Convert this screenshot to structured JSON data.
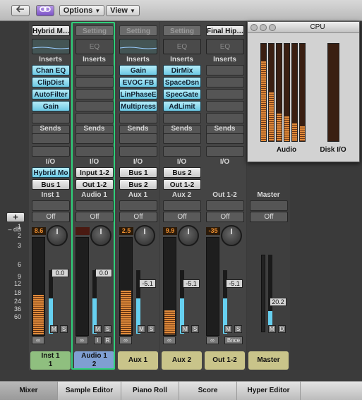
{
  "toolbar": {
    "options_label": "Options",
    "view_label": "View"
  },
  "colors": {
    "plugin": "#6cc9e4",
    "selected_outline": "#2fd07a",
    "fader_fill": "#66d0f0",
    "cpu_meter": "#e08a3a"
  },
  "strip_labels": {
    "inserts": "Inserts",
    "sends": "Sends",
    "io": "I/O",
    "setting": "Setting",
    "eq": "EQ",
    "off": "Off"
  },
  "strips": [
    {
      "setting": "Hybrid M…",
      "inserts": [
        "Chan EQ",
        "ClipDist",
        "AutoFilter",
        "Gain"
      ],
      "input": "Hybrid Mo",
      "output": "Bus 1",
      "title": "Inst 1",
      "peak": "8.6",
      "vol": "0.0",
      "name_line1": "Inst 1",
      "name_line2": "1",
      "name_color": "#8fbf7f"
    },
    {
      "setting": "Setting",
      "inserts": [],
      "input": "Input 1-2",
      "output": "Out 1-2",
      "title": "Audio 1",
      "peak": "",
      "vol": "0.0",
      "name_line1": "Audio 1",
      "name_line2": "2",
      "name_color": "#7f9fd2"
    },
    {
      "setting": "Setting",
      "inserts": [
        "Gain",
        "EVOC FB",
        "LinPhaseE",
        "Multipress"
      ],
      "input": "Bus 1",
      "output": "Bus 2",
      "title": "Aux 1",
      "peak": "2.5",
      "vol": "-5.1",
      "name_line1": "Aux 1",
      "name_line2": "",
      "name_color": "#c9c48a"
    },
    {
      "setting": "Setting",
      "inserts": [
        "DirMix",
        "SpaceDsn",
        "SpecGate",
        "AdLimit"
      ],
      "input": "Bus 2",
      "output": "Out 1-2",
      "title": "Aux 2",
      "peak": "9.9",
      "vol": "-5.1",
      "name_line1": "Aux 2",
      "name_line2": "",
      "name_color": "#c9c48a"
    },
    {
      "setting": "Final Hip…",
      "inserts": [],
      "input": "",
      "output": "",
      "title": "Out 1-2",
      "peak": "-35",
      "vol": "-5.1",
      "name_line1": "Out 1-2",
      "name_line2": "",
      "name_color": "#c9c48a",
      "bounce": "Bnce"
    },
    {
      "setting": "",
      "inserts": [],
      "input": "",
      "output": "",
      "title": "Master",
      "peak": "",
      "vol": "20.2",
      "name_line1": "Master",
      "name_line2": "",
      "name_color": "#c9c48a"
    }
  ],
  "scale": {
    "db_label": "– dB",
    "ticks": [
      "1",
      "2",
      "3",
      "6",
      "9",
      "12",
      "18",
      "24",
      "36",
      "60"
    ]
  },
  "cpu": {
    "title": "CPU",
    "audio_label": "Audio",
    "disk_label": "Disk I/O",
    "audio_levels": [
      0.82,
      0.5,
      0.28,
      0.25,
      0.18,
      0.15
    ],
    "disk_level": 0
  },
  "tabs": [
    "Mixer",
    "Sample Editor",
    "Piano Roll",
    "Score",
    "Hyper Editor"
  ],
  "ms": {
    "mute": "M",
    "solo": "S",
    "input": "I",
    "rec": "R",
    "dim": "D"
  }
}
